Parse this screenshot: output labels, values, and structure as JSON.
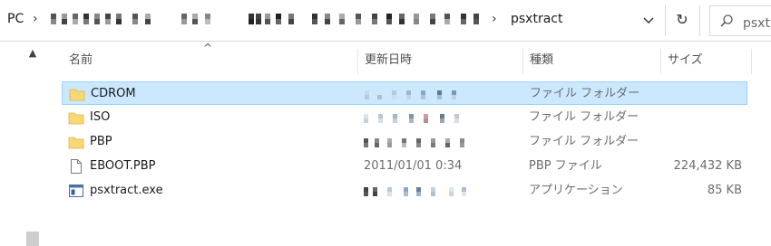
{
  "address_bar": {
    "root_label": "PC",
    "current_folder": "psxtract",
    "search_placeholder": "psxtract の検索"
  },
  "columns": {
    "name": "名前",
    "date": "更新日時",
    "type": "種類",
    "size": "サイズ"
  },
  "files": [
    {
      "name": "CDROM",
      "icon": "folder-icon",
      "date": "",
      "type": "ファイル フォルダー",
      "size": "",
      "selected": true
    },
    {
      "name": "ISO",
      "icon": "folder-icon",
      "date": "",
      "type": "ファイル フォルダー",
      "size": ""
    },
    {
      "name": "PBP",
      "icon": "folder-icon",
      "date": "",
      "type": "ファイル フォルダー",
      "size": ""
    },
    {
      "name": "EBOOT.PBP",
      "icon": "document-icon",
      "date": "2011/01/01 0:34",
      "type": "PBP ファイル",
      "size": "224,432 KB"
    },
    {
      "name": "psxtract.exe",
      "icon": "application-icon",
      "date": "",
      "type": "アプリケーション",
      "size": "85 KB"
    }
  ],
  "colors": {
    "selection_fill": "#cce8ff",
    "selection_border": "#99d1ff",
    "folder_yellow": "#f8d775"
  }
}
